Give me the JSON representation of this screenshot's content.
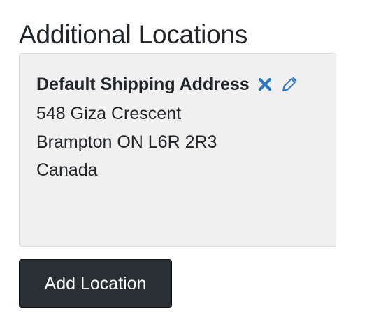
{
  "section": {
    "title": "Additional Locations"
  },
  "location_card": {
    "title": "Default Shipping Address",
    "address_line1": "548 Giza Crescent",
    "address_line2": "Brampton ON L6R 2R3",
    "address_line3": "Canada",
    "delete_icon": "close-icon",
    "edit_icon": "pencil-icon"
  },
  "actions": {
    "add_location_label": "Add Location"
  },
  "colors": {
    "icon_blue": "#2f77c0",
    "card_background": "#f0f0f0",
    "button_background": "#2a2f33",
    "text": "#212529"
  }
}
